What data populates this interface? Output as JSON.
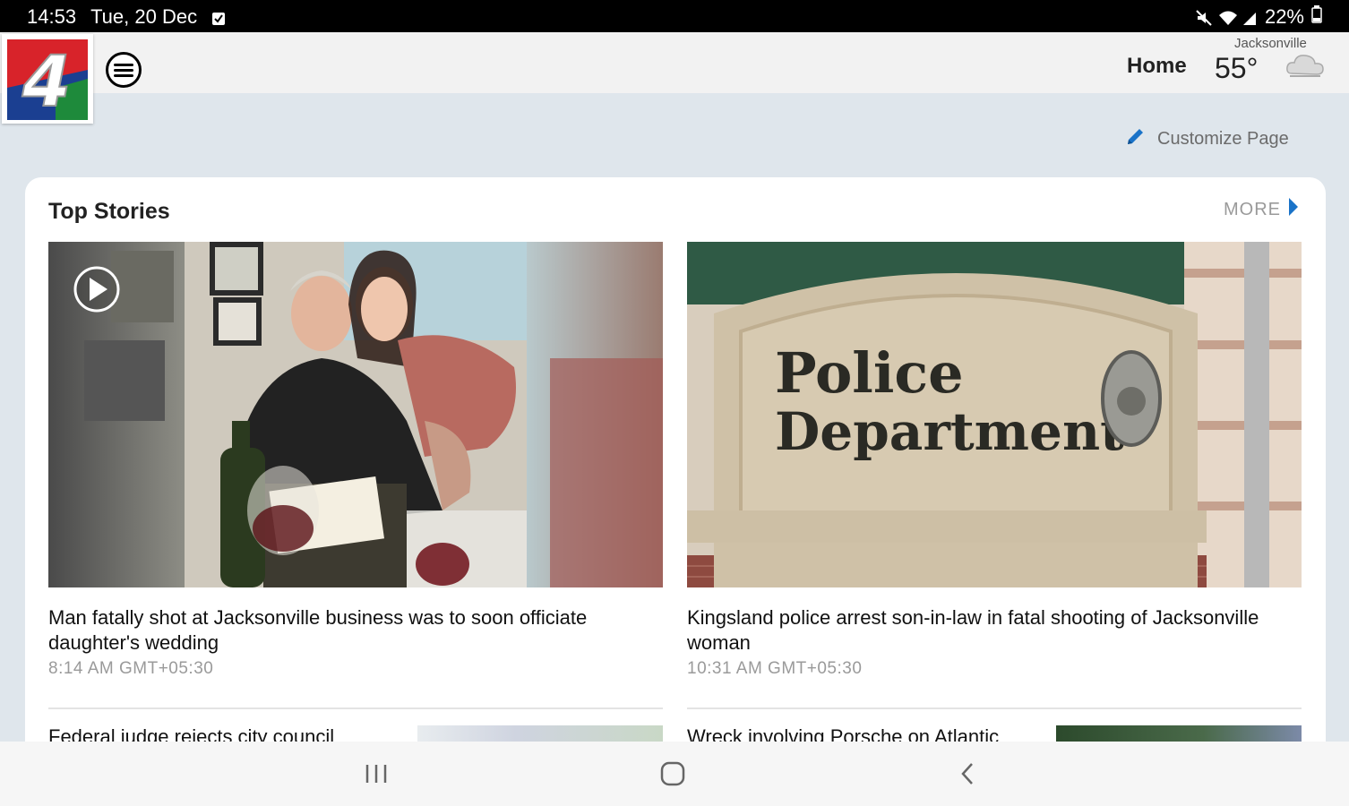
{
  "status_bar": {
    "time": "14:53",
    "date": "Tue, 20 Dec",
    "battery": "22%"
  },
  "header": {
    "home_label": "Home",
    "city": "Jacksonville",
    "temperature": "55°",
    "logo_text": "4"
  },
  "customize": {
    "label": "Customize Page"
  },
  "top_stories": {
    "title": "Top Stories",
    "more_label": "MORE",
    "stories": [
      {
        "headline": "Man fatally shot at Jacksonville business was to soon officiate daughter's wedding",
        "time": "8:14 AM GMT+05:30",
        "has_video": true
      },
      {
        "headline": "Kingsland police arrest son-in-law in fatal shooting of Jacksonville woman",
        "time": "10:31 AM GMT+05:30",
        "sign_line1": "Police",
        "sign_line2": "Department"
      }
    ],
    "next_stories": [
      {
        "headline": "Federal judge rejects city council"
      },
      {
        "headline": "Wreck involving Porsche on Atlantic"
      }
    ]
  },
  "colors": {
    "accent_blue": "#1a73c8",
    "background": "#dfe6ec"
  },
  "icons": [
    "notification-check-icon",
    "mute-icon",
    "wifi-icon",
    "signal-icon",
    "battery-icon",
    "menu-icon",
    "cloud-icon",
    "pencil-icon",
    "chevron-right-icon",
    "play-icon",
    "recents-icon",
    "home-circle-icon",
    "back-icon"
  ]
}
